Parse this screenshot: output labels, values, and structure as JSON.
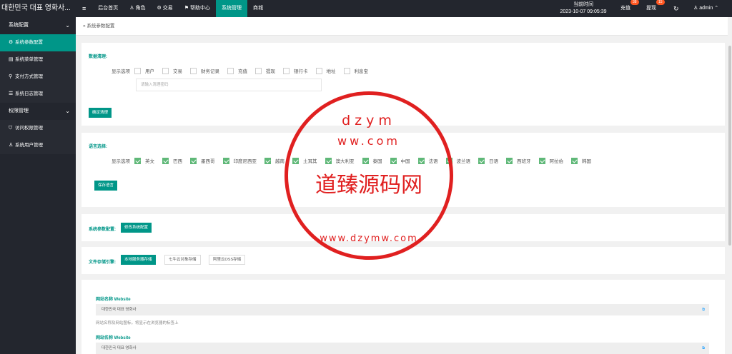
{
  "topbar": {
    "brand": "대한민국 대표 영화사...",
    "menu_icon": "menu-icon",
    "nav": [
      {
        "label": "后台首页",
        "icon": ""
      },
      {
        "label": "角色",
        "icon": "user-icon"
      },
      {
        "label": "交易",
        "icon": "gear-icon"
      },
      {
        "label": "帮助中心",
        "icon": "flag-icon"
      },
      {
        "label": "系统管理",
        "icon": ""
      },
      {
        "label": "商城",
        "icon": ""
      }
    ],
    "time_label": "当前时间",
    "time_value": "2023-10-07 09:05:39",
    "recharge": "充值",
    "recharge_count": "38",
    "withdraw": "提现",
    "withdraw_count": "15",
    "refresh_icon": "refresh-icon",
    "user": "admin"
  },
  "sidebar": {
    "group1": "系统配置",
    "group1_items": [
      "系统参数配置",
      "系统菜单管理",
      "支付方式管理",
      "系统日志管理"
    ],
    "group2": "权限管理",
    "group2_items": [
      "访问权限管理",
      "系统用户管理"
    ]
  },
  "breadcrumb": "系统参数配置",
  "data_clean": {
    "title": "数据清理:",
    "label": "显示选项",
    "options": [
      "用户",
      "交易",
      "财务记录",
      "充值",
      "提现",
      "银行卡",
      "地址",
      "利息宝"
    ],
    "password_placeholder": "请输入清理密码",
    "button": "确定清理"
  },
  "language": {
    "title": "语言选择:",
    "label": "显示选项",
    "options": [
      "英文",
      "巴西",
      "墨西哥",
      "印度尼西亚",
      "越南",
      "土耳其",
      "澳大利亚",
      "泰国",
      "中国",
      "法语",
      "波兰语",
      "日语",
      "西班牙",
      "阿拉伯",
      "韩国"
    ],
    "button": "保存语言"
  },
  "system_params": {
    "title": "系统参数配置:",
    "button": "修改系统配置"
  },
  "storage": {
    "title": "文件存储引擎:",
    "options": [
      "本地服务器存储",
      "七牛云对象存储",
      "阿里云OSS存储"
    ]
  },
  "website": {
    "label": "网站名称 Website",
    "value": "대한민국 대표 영화사",
    "hint": "网站名称及网站图标，将显示在浏览器的标签上",
    "label2": "网站名称 Website",
    "value2": "대한민국 대표 영화사"
  },
  "watermark": {
    "center": "道臻源码网",
    "ring_top": "dzym",
    "ring_dots": "ww.com",
    "ring_bottom": "www.dzymw.com"
  }
}
